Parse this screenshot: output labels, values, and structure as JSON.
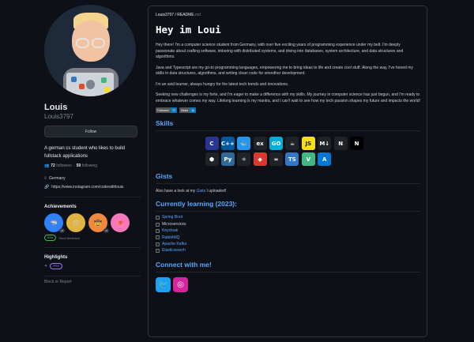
{
  "profile": {
    "name": "Louis",
    "login": "Louis3797",
    "follow_label": "Follow",
    "bio": "A german cs student who likes to build fullstack applications",
    "followers_count": "72",
    "followers_label": "followers",
    "following_count": "59",
    "following_label": "following",
    "dot": "·",
    "location": "Germany",
    "link": "https://www.instagram.com/codewithlouis"
  },
  "achievements": {
    "title": "Achievements",
    "badges": [
      {
        "icon": "pull-shark-icon",
        "glyph": "🦈",
        "count": "x3"
      },
      {
        "icon": "yolo-icon",
        "glyph": "🙃",
        "count": ""
      },
      {
        "icon": "quickdraw-icon",
        "glyph": "🤠",
        "count": "x3"
      },
      {
        "icon": "pair-extraordinaire-icon",
        "glyph": "🐙",
        "count": ""
      }
    ],
    "beta_label": "Beta",
    "send_feedback": "Send feedback"
  },
  "highlights": {
    "title": "Highlights",
    "pro_label": "PRO",
    "block_label": "Block or Report"
  },
  "readme": {
    "crumb_user": "Louis3797",
    "crumb_sep": " / ",
    "crumb_file": "README",
    "crumb_ext": ".md",
    "greeting": "Hey im Loui",
    "paragraphs": [
      "Hey there! I'm a computer science student from Germany, with over five exciting years of programming experience under my belt. I'm deeply passionate about crafting software, tinkering with distributed systems, and diving into databases, system architecture, and data structures and algorithms.",
      "Java and Typescript are my go-to programming languages, empowering me to bring ideas to life and create cool stuff. Along the way, I've honed my skills in data structures, algorithms, and writing clean code for smoother development.",
      "I'm an avid learner, always hungry for the latest tech trends and innovations.",
      "Seeking new challenges is my forte, and I'm eager to make a difference with my skills. My journey in computer science has just begun, and I'm ready to embrace whatever comes my way. Lifelong learning is my mantra, and I can't wait to see how my tech passion shapes my future and impacts the world!"
    ],
    "shields": [
      {
        "label": "Followers",
        "value": "72"
      },
      {
        "label": "Views",
        "value": "1k"
      }
    ],
    "skills_title": "Skills",
    "skills": [
      {
        "icon": "c-icon",
        "text": "C",
        "bg": "#283593"
      },
      {
        "icon": "cpp-icon",
        "text": "C++",
        "bg": "#00599c"
      },
      {
        "icon": "docker-icon",
        "text": "🐳",
        "bg": "#2496ed"
      },
      {
        "icon": "express-icon",
        "text": "ex",
        "bg": "#1f2328"
      },
      {
        "icon": "go-icon",
        "text": "GO",
        "bg": "#00add8"
      },
      {
        "icon": "java-icon",
        "text": "☕",
        "bg": "#1f2328"
      },
      {
        "icon": "javascript-icon",
        "text": "JS",
        "bg": "#f7df1e"
      },
      {
        "icon": "markdown-icon",
        "text": "M↓",
        "bg": "#1f2328"
      },
      {
        "icon": "neovim-icon",
        "text": "N",
        "bg": "#1f2328"
      },
      {
        "icon": "nextjs-icon",
        "text": "N",
        "bg": "#000000"
      },
      {
        "icon": "nodejs-icon",
        "text": "⬢",
        "bg": "#1f2328"
      },
      {
        "icon": "python-icon",
        "text": "Py",
        "bg": "#306998"
      },
      {
        "icon": "react-icon",
        "text": "⚛",
        "bg": "#1f2328"
      },
      {
        "icon": "redis-icon",
        "text": "◆",
        "bg": "#dc382d"
      },
      {
        "icon": "tailwind-icon",
        "text": "≈",
        "bg": "#1f2328"
      },
      {
        "icon": "typescript-icon",
        "text": "TS",
        "bg": "#3178c6"
      },
      {
        "icon": "vue-icon",
        "text": "V",
        "bg": "#41b883"
      },
      {
        "icon": "azure-icon",
        "text": "A",
        "bg": "#0078d4"
      }
    ],
    "gists_title": "Gists",
    "gists_text": "Also have a look at my ",
    "gists_link": "Gists",
    "gists_tail": " I uploaded!",
    "learning_title": "Currently learning (2023):",
    "learning": [
      {
        "label": "Spring Boot",
        "link": true
      },
      {
        "label": "Microservices",
        "link": false
      },
      {
        "label": "Keycloak",
        "link": true
      },
      {
        "label": "RabbitMQ",
        "link": true
      },
      {
        "label": "Apache Kafka",
        "link": true
      },
      {
        "label": "Elasticsearch",
        "link": true
      }
    ],
    "connect_title": "Connect with me!",
    "social": [
      {
        "icon": "twitter-icon",
        "text": "🐦",
        "bg": "#1da1f2"
      },
      {
        "icon": "instagram-icon",
        "text": "◎",
        "bg": "#d6249f"
      }
    ]
  },
  "icons": {
    "location": "location-pin-icon",
    "link": "link-icon",
    "people": "people-icon",
    "star": "star-icon"
  }
}
